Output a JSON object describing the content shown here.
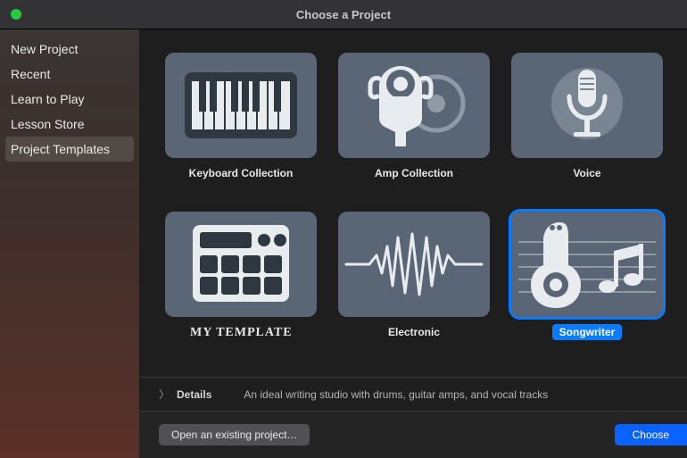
{
  "window": {
    "title": "Choose a Project"
  },
  "sidebar": {
    "items": [
      {
        "label": "New Project",
        "selected": false
      },
      {
        "label": "Recent",
        "selected": false
      },
      {
        "label": "Learn to Play",
        "selected": false
      },
      {
        "label": "Lesson Store",
        "selected": false
      },
      {
        "label": "Project Templates",
        "selected": true
      }
    ]
  },
  "templates": [
    {
      "id": "keyboard-collection",
      "label": "Keyboard Collection",
      "icon": "keyboard",
      "selected": false
    },
    {
      "id": "amp-collection",
      "label": "Amp Collection",
      "icon": "amp",
      "selected": false
    },
    {
      "id": "voice",
      "label": "Voice",
      "icon": "mic",
      "selected": false
    },
    {
      "id": "my-template",
      "label": "MY TEMPLATE",
      "icon": "drummachine",
      "handwritten": true,
      "selected": false
    },
    {
      "id": "electronic",
      "label": "Electronic",
      "icon": "wave",
      "selected": false
    },
    {
      "id": "songwriter",
      "label": "Songwriter",
      "icon": "guitar-notes",
      "selected": true
    }
  ],
  "details": {
    "label": "Details",
    "text": "An ideal writing studio with drums, guitar amps, and vocal tracks"
  },
  "footer": {
    "open_label": "Open an existing project…",
    "choose_label": "Choose"
  },
  "colors": {
    "tile_bg": "#5a6675",
    "accent": "#0a7cff",
    "icon_light": "#e8ecef",
    "icon_dark": "#2f3740"
  }
}
